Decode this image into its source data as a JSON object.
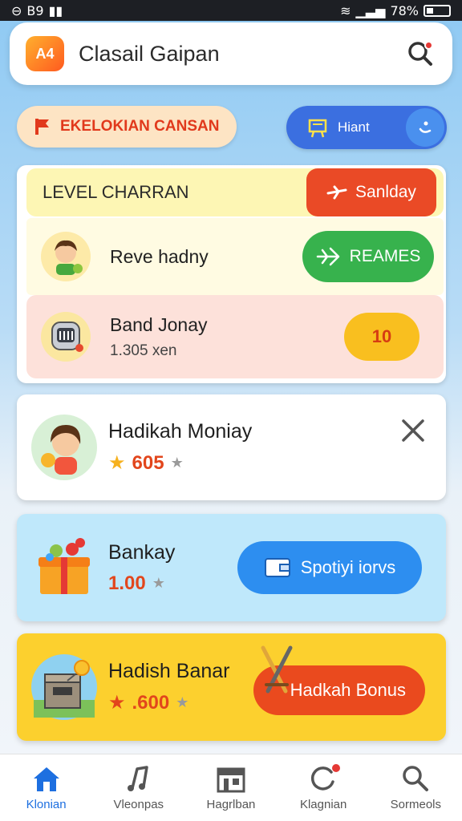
{
  "status_bar": {
    "left_text": "B9",
    "battery": "78%"
  },
  "header": {
    "title": "Clasail Gaipan",
    "logo_text": "A4",
    "search_icon": "search-icon"
  },
  "promo_pills": {
    "orange": {
      "label": "EKELOKIAN CANSAN",
      "icon": "flag-icon"
    },
    "blue": {
      "label": "Hiant",
      "icon": "board-icon"
    }
  },
  "level_section": {
    "level_label": "LEVEL CHARRAN",
    "sunday_button": "Sanlday",
    "rows": [
      {
        "title": "Reve hadny",
        "button": "REAMES"
      },
      {
        "title": "Band Jonay",
        "subtitle": "1.305 xen",
        "button": "10"
      }
    ]
  },
  "cards": [
    {
      "title": "Hadikah Moniay",
      "points": "605"
    },
    {
      "title": "Bankay",
      "points": "1.00",
      "button": "Spotiyi iorvs"
    },
    {
      "title": "Hadish Banar",
      "points": ".600",
      "button": "Hadkah Bonus"
    }
  ],
  "bottom_nav": [
    {
      "label": "Klonian",
      "icon": "home-icon",
      "active": true
    },
    {
      "label": "Vleonpas",
      "icon": "music-icon"
    },
    {
      "label": "Hagrlban",
      "icon": "store-icon"
    },
    {
      "label": "Klagnian",
      "icon": "refresh-icon"
    },
    {
      "label": "Sormeols",
      "icon": "search-icon"
    }
  ],
  "colors": {
    "accent_blue": "#2d8ef0",
    "accent_red": "#ea4a26",
    "accent_green": "#37b24d",
    "accent_gold": "#fcd02e"
  }
}
